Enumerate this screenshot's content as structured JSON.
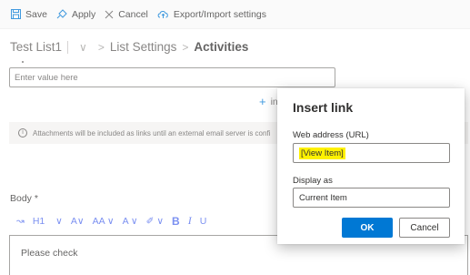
{
  "toolbar": {
    "save_label": "Save",
    "apply_label": "Apply",
    "cancel_label": "Cancel",
    "export_label": "Export/Import settings"
  },
  "breadcrumb": {
    "list_name": "Test List1",
    "settings": "List Settings",
    "current": "Activities"
  },
  "form": {
    "value_placeholder": "Enter value here",
    "insert_label": "in",
    "info_text": "Attachments will be included as links until an external email server is confi",
    "body_label": "Body *",
    "editor_text": "Please check"
  },
  "format_bar": {
    "heading": "H1",
    "bold": "B",
    "italic": "I",
    "underline": "U"
  },
  "dialog": {
    "title": "Insert link",
    "url_label": "Web address (URL)",
    "url_value": "[View Item]",
    "display_label": "Display as",
    "display_value": "Current Item",
    "ok_label": "OK",
    "cancel_label": "Cancel"
  },
  "colors": {
    "accent": "#0078d4",
    "highlight": "#fff100"
  }
}
